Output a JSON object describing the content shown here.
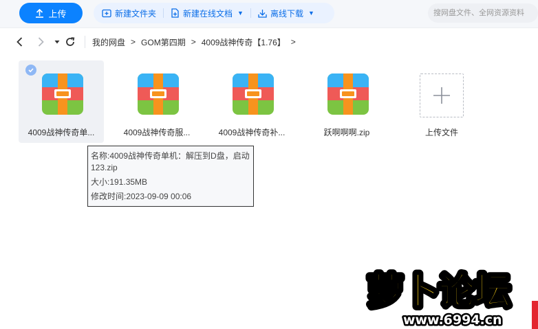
{
  "toolbar": {
    "upload_label": "上传",
    "new_folder_label": "新建文件夹",
    "new_online_doc_label": "新建在线文档",
    "offline_download_label": "离线下载",
    "search_placeholder": "搜网盘文件、全网资源资料"
  },
  "breadcrumb": [
    "我的网盘",
    "GOM第四期",
    "4009战神传奇【1.76】"
  ],
  "files": [
    {
      "name": "4009战神传奇单机：解压到D盘，启动123.zip",
      "display": "4009战神传奇单...",
      "selected": true
    },
    {
      "name": "4009战神传奇服...",
      "display": "4009战神传奇服...",
      "selected": false
    },
    {
      "name": "4009战神传奇补...",
      "display": "4009战神传奇补...",
      "selected": false
    },
    {
      "name": "跃啊啊啊.zip",
      "display": "跃啊啊啊.zip",
      "selected": false
    }
  ],
  "upload_tile_label": "上传文件",
  "tooltip": {
    "name_line": "名称:4009战神传奇单机：解压到D盘，启动123.zip",
    "size_line": "大小:191.35MB",
    "modified_line": "修改时间:2023-09-09 00:06"
  },
  "watermark": {
    "title": "萝卜论坛",
    "url": "www.6994.cn"
  },
  "colors": {
    "accent": "#0b82ff",
    "action_text": "#0b6ee8",
    "archive_top": "#3ab3f5",
    "archive_mid": "#ef5a57",
    "archive_bottom": "#7cc442",
    "archive_strap": "#f7931e"
  },
  "icons": {
    "upload": "upload-arrow-icon",
    "new_folder": "new-folder-icon",
    "new_doc": "new-doc-icon",
    "download": "download-icon",
    "back": "chevron-left-icon",
    "forward": "chevron-right-icon",
    "dropdown": "caret-down-icon",
    "refresh": "refresh-icon",
    "archive": "archive-zip-icon",
    "add": "plus-icon",
    "check": "check-icon"
  }
}
